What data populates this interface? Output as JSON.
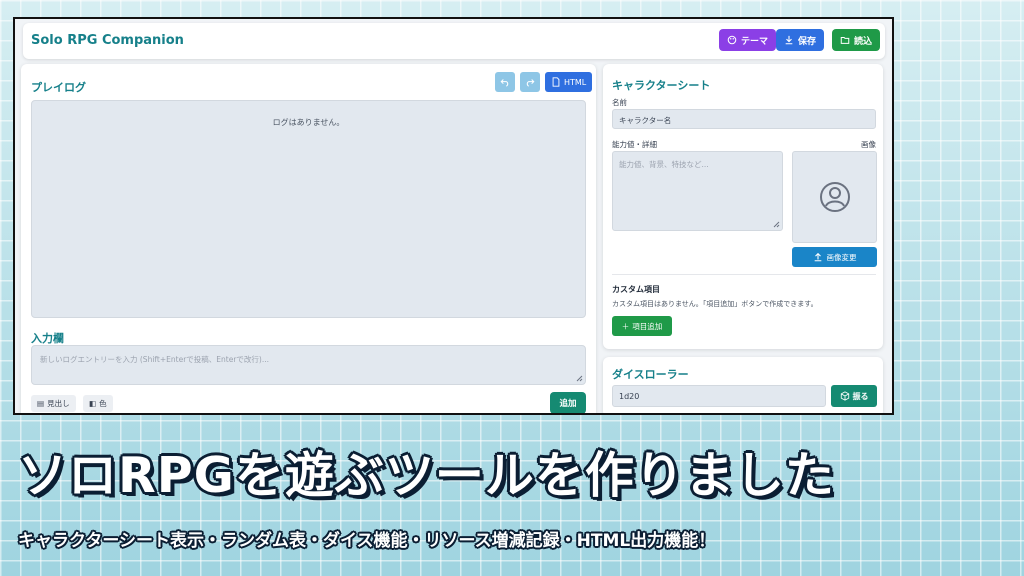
{
  "app": {
    "title": "Solo RPG Companion",
    "buttons": {
      "theme": "テーマ",
      "save": "保存",
      "load": "読込"
    }
  },
  "play_log": {
    "title": "プレイログ",
    "html_label": "HTML",
    "empty_text": "ログはありません。",
    "input_title": "入力欄",
    "input_placeholder": "新しいログエントリーを入力 (Shift+Enterで投稿、Enterで改行)...",
    "heading_chip": "見出し",
    "color_chip": "色",
    "add_label": "追加"
  },
  "character_sheet": {
    "title": "キャラクターシート",
    "name_label": "名前",
    "name_value": "キャラクター名",
    "stats_label": "能力値・詳細",
    "stats_placeholder": "能力値、背景、特技など...",
    "image_label": "画像",
    "change_image_label": "画像変更",
    "custom_title": "カスタム項目",
    "custom_empty": "カスタム項目はありません。「項目追加」ボタンで作成できます。",
    "add_item_label": "項目追加"
  },
  "dice": {
    "title": "ダイスローラー",
    "value": "1d20",
    "roll_label": "振る"
  },
  "banner": {
    "headline": "ソロRPGを遊ぶツールを作りました",
    "subline": "キャラクターシート表示・ランダム表・ダイス機能・リソース増減記録・HTML出力機能！"
  },
  "colors": {
    "accent": "#16808a",
    "theme_button": "#8b3fe6",
    "save_button": "#2f6fe0",
    "load_button": "#1f9a48",
    "roll_button": "#158a72"
  }
}
